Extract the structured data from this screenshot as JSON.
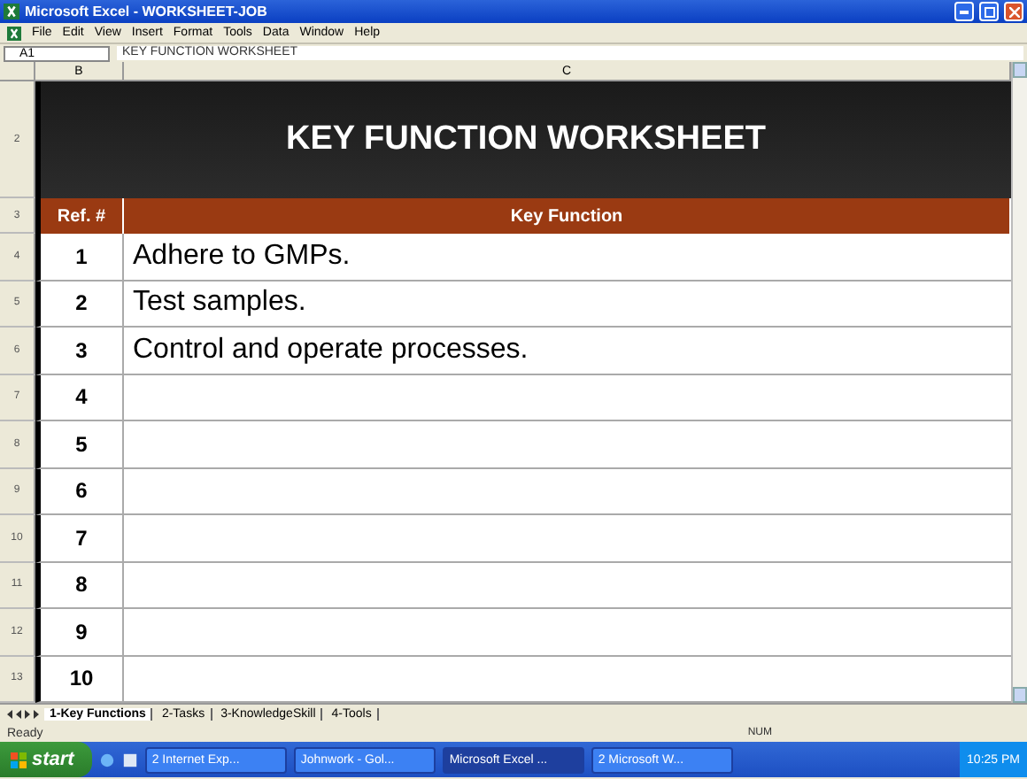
{
  "window": {
    "title": "Microsoft Excel - WORKSHEET-JOB"
  },
  "menu": [
    "File",
    "Edit",
    "View",
    "Insert",
    "Format",
    "Tools",
    "Data",
    "Window",
    "Help"
  ],
  "formula_bar": {
    "cell": "A1",
    "content": "KEY FUNCTION WORKSHEET"
  },
  "column_headers": [
    "B",
    "C"
  ],
  "sheet": {
    "banner": {
      "row": "2",
      "title": "KEY FUNCTION WORKSHEET"
    },
    "header": {
      "row": "3",
      "columns": [
        "Ref. #",
        "Key Function"
      ]
    },
    "rows": [
      {
        "row": "4",
        "ref": "1",
        "function": "Adhere to GMPs."
      },
      {
        "row": "5",
        "ref": "2",
        "function": "Test samples."
      },
      {
        "row": "6",
        "ref": "3",
        "function": "Control and operate processes."
      },
      {
        "row": "7",
        "ref": "4"
      },
      {
        "row": "8",
        "ref": "5"
      },
      {
        "row": "9",
        "ref": "6"
      },
      {
        "row": "10",
        "ref": "7"
      },
      {
        "row": "11",
        "ref": "8"
      },
      {
        "row": "12",
        "ref": "9"
      },
      {
        "row": "13",
        "ref": "10"
      }
    ]
  },
  "sheet_tabs": [
    {
      "label": "1-Key Functions",
      "selected": true
    },
    {
      "label": "2-Tasks",
      "selected": false
    },
    {
      "label": "3-KnowledgeSkill",
      "selected": false
    },
    {
      "label": "4-Tools",
      "selected": false
    }
  ],
  "status_bar": {
    "text": "Ready",
    "indicator": "NUM"
  },
  "taskbar": {
    "start": "start",
    "buttons": [
      {
        "label": "2 Internet Exp...",
        "selected": false
      },
      {
        "label": "Johnwork - Gol...",
        "selected": false
      },
      {
        "label": "Microsoft Excel ...",
        "selected": true
      },
      {
        "label": "2 Microsoft W...",
        "selected": false
      }
    ],
    "clock": "10:25 PM"
  }
}
